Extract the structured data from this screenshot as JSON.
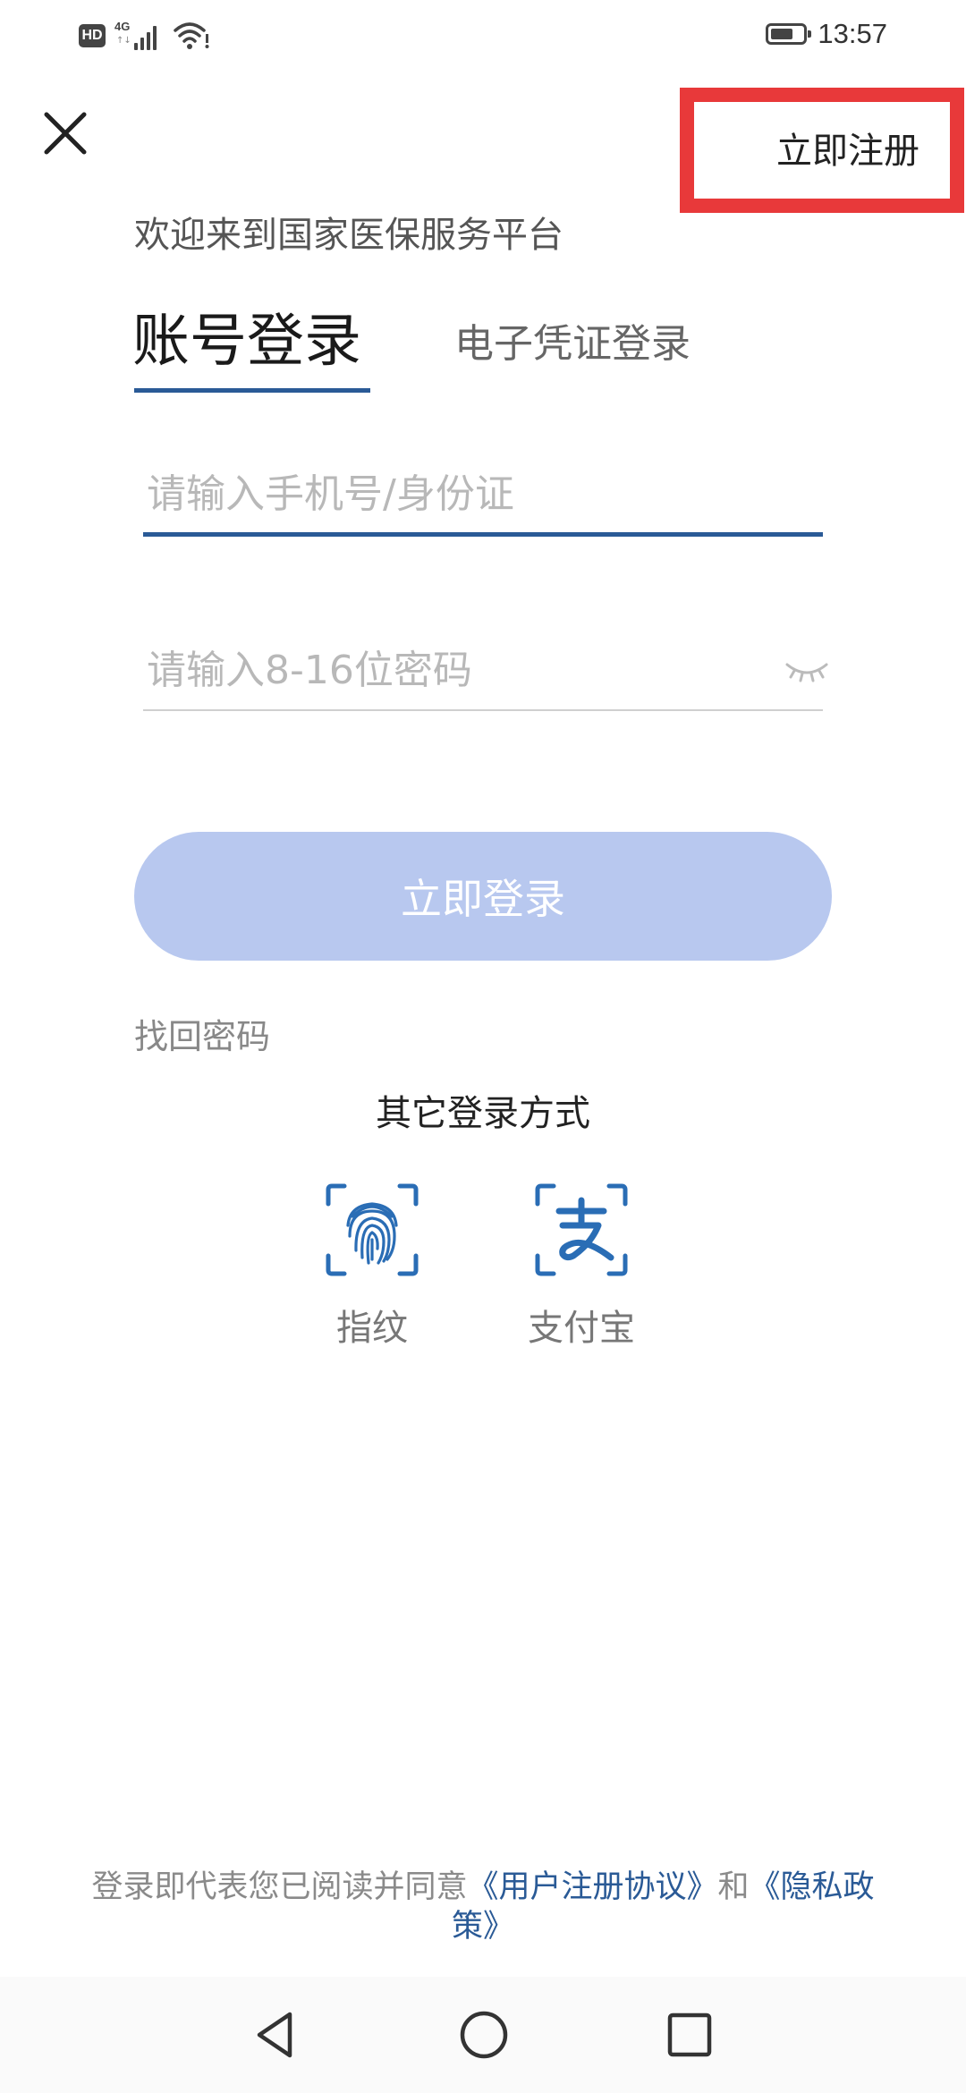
{
  "status_bar": {
    "hd_label": "HD",
    "network_label": "4G",
    "time": "13:57"
  },
  "header": {
    "close_icon": "close-icon",
    "register_label": "立即注册",
    "highlight_color": "#e8393a"
  },
  "welcome_text": "欢迎来到国家医保服务平台",
  "tabs": [
    {
      "label": "账号登录",
      "active": true
    },
    {
      "label": "电子凭证登录",
      "active": false
    }
  ],
  "form": {
    "phone_placeholder": "请输入手机号/身份证",
    "password_placeholder": "请输入8-16位密码",
    "password_visibility_icon": "eye-closed-icon"
  },
  "login_button_label": "立即登录",
  "forgot_password_label": "找回密码",
  "other_login": {
    "title": "其它登录方式",
    "options": [
      {
        "label": "指纹",
        "icon": "fingerprint-icon"
      },
      {
        "label": "支付宝",
        "icon": "alipay-icon"
      }
    ]
  },
  "agreement": {
    "prefix": "登录即代表您已阅读并同意",
    "user_agreement": "《用户注册协议》",
    "and": "和",
    "privacy_policy": "《隐私政策》"
  },
  "nav_bar": {
    "back_icon": "back-triangle-icon",
    "home_icon": "home-circle-icon",
    "recent_icon": "recent-square-icon"
  },
  "colors": {
    "accent": "#2a5a96",
    "button_disabled": "#b8c8ef",
    "icon_blue": "#2a6db5"
  }
}
